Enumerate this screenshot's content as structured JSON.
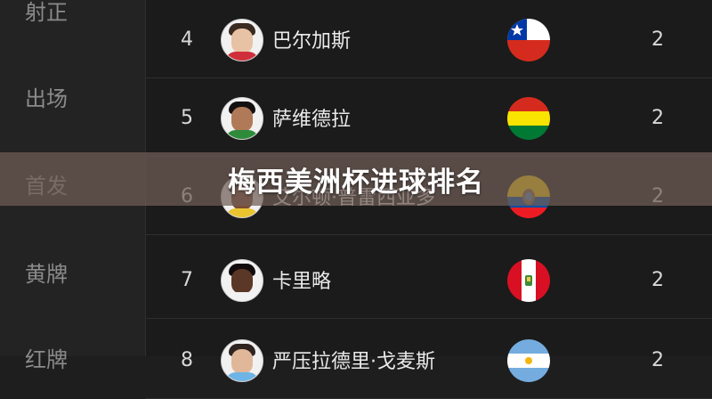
{
  "sidebar": {
    "items": [
      {
        "label": "射正"
      },
      {
        "label": "出场"
      },
      {
        "label": "首发"
      },
      {
        "label": "黄牌"
      },
      {
        "label": "红牌"
      }
    ]
  },
  "rows": [
    {
      "rank": "4",
      "name": "巴尔加斯",
      "country_flag": "chile-flag",
      "goals": "2"
    },
    {
      "rank": "5",
      "name": "萨维德拉",
      "country_flag": "bolivia-flag",
      "goals": "2"
    },
    {
      "rank": "6",
      "name": "艾尔顿·普雷西亚多",
      "country_flag": "ecuador-flag",
      "goals": "2"
    },
    {
      "rank": "7",
      "name": "卡里略",
      "country_flag": "peru-flag",
      "goals": "2"
    },
    {
      "rank": "8",
      "name": "严压拉德里·戈麦斯",
      "country_flag": "argentina-flag",
      "goals": "2"
    }
  ],
  "banner": {
    "title": "梅西美洲杯进球排名"
  },
  "colors": {
    "background": "#1b1b1b",
    "sidebar": "#232323",
    "text": "#eaeaea",
    "muted_text": "#8b8b8b",
    "banner": "#705e57"
  }
}
